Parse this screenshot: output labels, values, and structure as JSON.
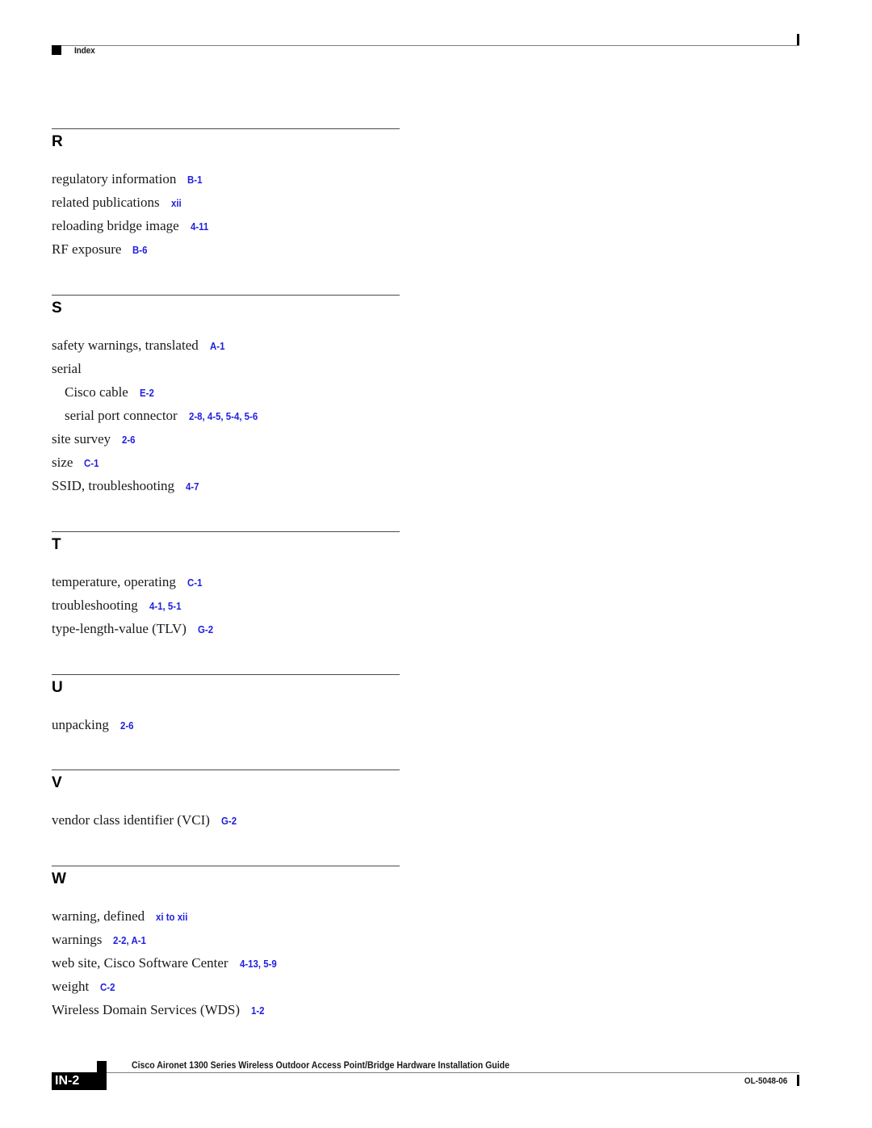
{
  "header": {
    "section_label": "Index"
  },
  "sections": [
    {
      "letter": "R",
      "entries": [
        {
          "term": "regulatory information",
          "refs": "B-1",
          "sub": false
        },
        {
          "term": "related publications",
          "refs": "xii",
          "sub": false
        },
        {
          "term": "reloading bridge image",
          "refs": "4-11",
          "sub": false
        },
        {
          "term": "RF exposure",
          "refs": "B-6",
          "sub": false
        }
      ]
    },
    {
      "letter": "S",
      "entries": [
        {
          "term": "safety warnings, translated",
          "refs": "A-1",
          "sub": false
        },
        {
          "term": "serial",
          "refs": "",
          "sub": false
        },
        {
          "term": "Cisco cable",
          "refs": "E-2",
          "sub": true
        },
        {
          "term": "serial port connector",
          "refs": "2-8, 4-5, 5-4, 5-6",
          "sub": true
        },
        {
          "term": "site survey",
          "refs": "2-6",
          "sub": false
        },
        {
          "term": "size",
          "refs": "C-1",
          "sub": false
        },
        {
          "term": "SSID, troubleshooting",
          "refs": "4-7",
          "sub": false
        }
      ]
    },
    {
      "letter": "T",
      "entries": [
        {
          "term": "temperature, operating",
          "refs": "C-1",
          "sub": false
        },
        {
          "term": "troubleshooting",
          "refs": "4-1, 5-1",
          "sub": false
        },
        {
          "term": "type-length-value (TLV)",
          "refs": "G-2",
          "sub": false
        }
      ]
    },
    {
      "letter": "U",
      "entries": [
        {
          "term": "unpacking",
          "refs": "2-6",
          "sub": false
        }
      ]
    },
    {
      "letter": "V",
      "entries": [
        {
          "term": "vendor class identifier (VCI)",
          "refs": "G-2",
          "sub": false
        }
      ]
    },
    {
      "letter": "W",
      "entries": [
        {
          "term": "warning, defined",
          "refs": "xi to xii",
          "sub": false
        },
        {
          "term": "warnings",
          "refs": "2-2, A-1",
          "sub": false
        },
        {
          "term": "web site, Cisco Software Center",
          "refs": "4-13, 5-9",
          "sub": false
        },
        {
          "term": "weight",
          "refs": "C-2",
          "sub": false
        },
        {
          "term": "Wireless Domain Services (WDS)",
          "refs": "1-2",
          "sub": false
        }
      ]
    }
  ],
  "footer": {
    "guide_title": "Cisco Aironet 1300 Series Wireless Outdoor Access Point/Bridge Hardware Installation Guide",
    "page_number": "IN-2",
    "doc_number": "OL-5048-06"
  },
  "colors": {
    "link": "#1f1fe0",
    "text": "#1a1a1a"
  }
}
